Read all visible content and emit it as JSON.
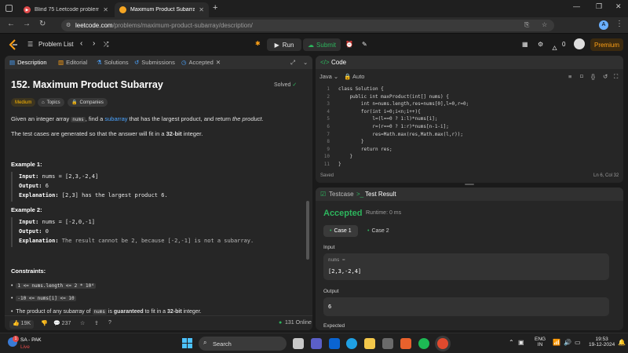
{
  "browser": {
    "tabs": [
      {
        "title": "Blind 75 Leetcode problems : D"
      },
      {
        "title": "Maximum Product Subarray - L"
      }
    ],
    "url_domain": "leetcode.com",
    "url_path": "/problems/maximum-product-subarray/description/"
  },
  "nav": {
    "problem_list": "Problem List",
    "run": "Run",
    "submit": "Submit",
    "streak": "0",
    "premium": "Premium",
    "avatar": "A"
  },
  "left": {
    "tabs": [
      "Description",
      "Editorial",
      "Solutions",
      "Submissions",
      "Accepted"
    ],
    "title": "152. Maximum Product Subarray",
    "solved": "Solved",
    "tags": [
      "Medium",
      "Topics",
      "Companies"
    ],
    "desc": {
      "p1_a": "Given an integer array ",
      "p1_code": "nums",
      "p1_b": ", find a ",
      "p1_link": "subarray",
      "p1_c": " that has the largest product, and return ",
      "p1_em": "the product",
      "p1_d": ".",
      "p2_a": "The test cases are generated so that the answer will fit in a ",
      "p2_b": "32-bit",
      "p2_c": " integer."
    },
    "examples": [
      {
        "heading": "Example 1:",
        "input_label": "Input:",
        "input": "nums = [2,3,-2,4]",
        "output_label": "Output:",
        "output": "6",
        "expl_label": "Explanation:",
        "expl": "[2,3] has the largest product 6."
      },
      {
        "heading": "Example 2:",
        "input_label": "Input:",
        "input": "nums = [-2,0,-1]",
        "output_label": "Output:",
        "output": "0",
        "expl_label": "Explanation:",
        "expl": "The result cannot be 2, because [-2,-1] is not a subarray."
      }
    ],
    "constraints_heading": "Constraints:",
    "constraints": [
      "1 <= nums.length <= 2 * 10⁴",
      "-10 <= nums[i] <= 10"
    ],
    "c3_a": "The product of any subarray of ",
    "c3_code": "nums",
    "c3_b": " is ",
    "c3_c": "guaranteed",
    "c3_d": " to fit in a ",
    "c3_e": "32-bit",
    "c3_f": " integer.",
    "likes": "19K",
    "comments": "237",
    "online": "131 Online"
  },
  "code": {
    "title": "Code",
    "language": "Java",
    "mode": "Auto",
    "lines": [
      "class Solution {",
      "    public int maxProduct(int[] nums) {",
      "        int n=nums.length,res=nums[0],l=0,r=0;",
      "        for(int i=0;i<n;i++){",
      "            l=(l==0 ? 1:l)*nums[i];",
      "            r=(r==0 ? 1:r)*nums[n-1-i];",
      "            res=Math.max(res,Math.max(l,r));",
      "        }",
      "        return res;",
      "    }",
      "}"
    ],
    "saved": "Saved",
    "cursor": "Ln 6, Col 32"
  },
  "result": {
    "tab_testcase": "Testcase",
    "tab_result": "Test Result",
    "status": "Accepted",
    "runtime": "Runtime: 0 ms",
    "cases": [
      "Case 1",
      "Case 2"
    ],
    "input_label": "Input",
    "input_name": "nums =",
    "input_value": "[2,3,-2,4]",
    "output_label": "Output",
    "output_value": "6",
    "expected_label": "Expected"
  },
  "taskbar": {
    "weather_temp": "1",
    "weather_name": "SA - PAK",
    "weather_status": "Live",
    "search": "Search",
    "lang1": "ENG",
    "lang2": "IN",
    "time": "19:53",
    "date": "19-12-2024"
  }
}
